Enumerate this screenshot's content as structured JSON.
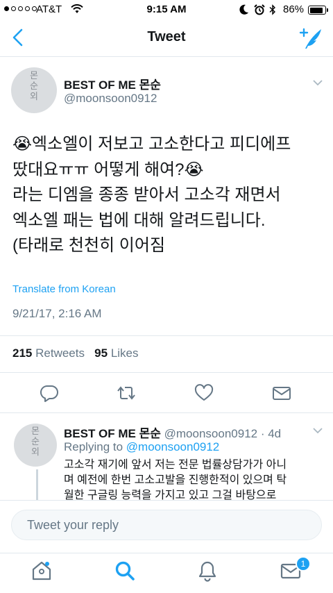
{
  "status_bar": {
    "carrier": "AT&T",
    "time": "9:15 AM",
    "battery_percent": "86%",
    "battery_level": 0.86,
    "signal_bars_filled": 1,
    "icons": [
      "wifi-icon",
      "moon-icon",
      "alarm-icon",
      "bluetooth-icon"
    ]
  },
  "nav": {
    "title": "Tweet",
    "back_icon": "chevron-left-icon",
    "compose_icon": "compose-quill-icon"
  },
  "tweet": {
    "author_name": "BEST OF ME 몬순",
    "author_handle": "@moonsoon0912",
    "avatar_text": "몬\n순\n외",
    "text": "😭엑소엘이 저보고 고소한다고 피디에프\n땄대요ㅠㅠ 어떻게 해여?😭\n라는 디엠을 종종 받아서 고소각 재면서\n엑소엘 패는 법에 대해 알려드립니다.\n(타래로 천천히 이어짐",
    "translate_label": "Translate from Korean",
    "timestamp": "9/21/17, 2:16 AM",
    "retweets_count": "215",
    "retweets_label": "Retweets",
    "likes_count": "95",
    "likes_label": "Likes",
    "actions": [
      "reply-icon",
      "retweet-icon",
      "like-icon",
      "direct-message-icon"
    ]
  },
  "reply": {
    "author_name": "BEST OF ME 몬순",
    "author_handle": "@moonsoon0912",
    "age": "· 4d",
    "replying_label": "Replying to",
    "replying_handle": "@moonsoon0912",
    "text": "고소각 재기에 앞서 저는 전문 법률상담가가 아니\n며 예전에 한번 고소고발을 진행한적이 있으며 탁\n월한 구글링 능력을 가지고 있고 그걸 바탕으로"
  },
  "composer": {
    "placeholder": "Tweet your reply"
  },
  "tabbar": {
    "items": [
      "home-icon",
      "search-icon",
      "notifications-icon",
      "messages-icon"
    ],
    "messages_badge": "1"
  },
  "colors": {
    "accent": "#1da1f2",
    "text": "#14171a",
    "secondary": "#657786",
    "divider": "#e1e8ed"
  }
}
